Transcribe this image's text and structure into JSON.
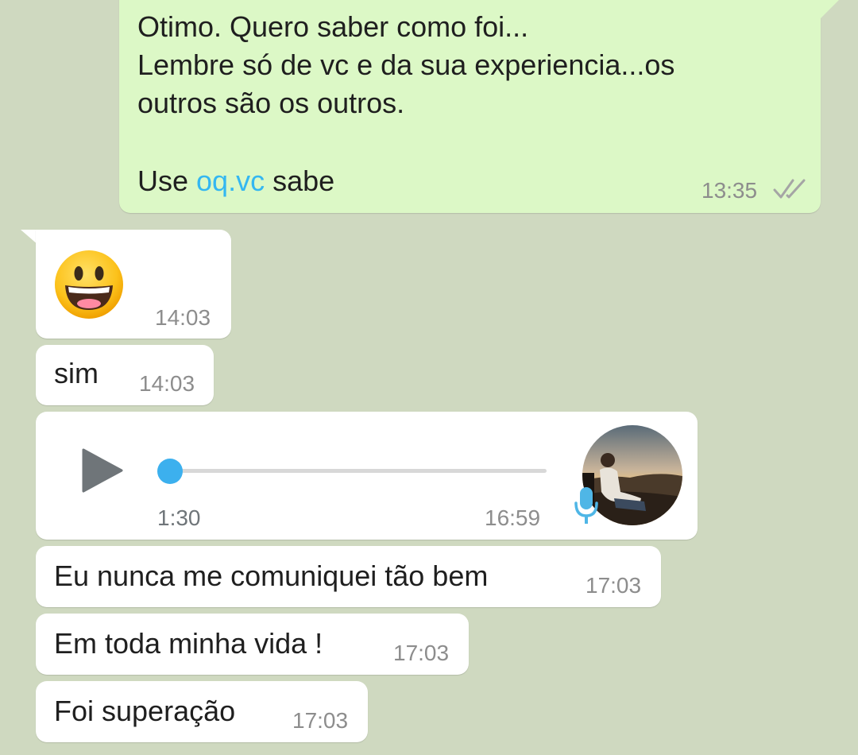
{
  "colors": {
    "chat_background": "#cfd9c0",
    "outgoing_bubble": "#dcf8c6",
    "incoming_bubble": "#ffffff",
    "link": "#34b7f1",
    "timestamp": "#8d8d8d",
    "voice_accent": "#4fb6e6"
  },
  "messages": {
    "m1": {
      "direction": "outgoing",
      "line1": "Otimo. Quero saber como foi...",
      "line2": "Lembre só de vc e da sua experiencia...os",
      "line3": "outros são os outros.",
      "line5_prefix": "Use ",
      "line5_link": "oq.vc",
      "line5_suffix": " sabe",
      "time": "13:35",
      "status_icon": "double-check-icon"
    },
    "m2": {
      "direction": "incoming",
      "emoji": "😃",
      "emoji_icon": "grinning-face-emoji",
      "time": "14:03"
    },
    "m3": {
      "direction": "incoming",
      "text": "sim",
      "time": "14:03"
    },
    "m4": {
      "direction": "incoming",
      "type": "voice",
      "duration": "1:30",
      "time": "16:59",
      "progress": 0,
      "play_icon": "play-icon",
      "mic_icon": "microphone-icon",
      "avatar": "sender-avatar-photo"
    },
    "m5": {
      "direction": "incoming",
      "text": "Eu nunca me comuniquei tão bem",
      "time": "17:03"
    },
    "m6": {
      "direction": "incoming",
      "text": "Em toda minha vida !",
      "time": "17:03"
    },
    "m7": {
      "direction": "incoming",
      "text": "Foi superação",
      "time": "17:03"
    }
  }
}
